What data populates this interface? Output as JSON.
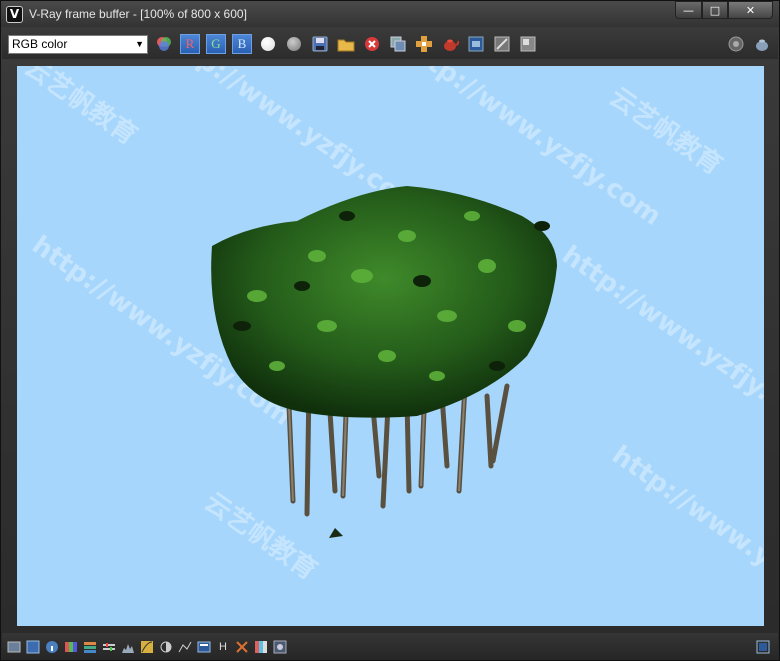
{
  "window": {
    "title": "V-Ray frame buffer - [100% of 800 x 600]",
    "icon": "vray-icon",
    "controls": [
      "minimize-icon",
      "maximize-icon",
      "close-icon"
    ]
  },
  "toolbar": {
    "channel_select": {
      "value": "RGB color"
    },
    "channel_buttons": [
      {
        "label": "R",
        "color": "#ff6060"
      },
      {
        "label": "G",
        "color": "#8fe28f"
      },
      {
        "label": "B",
        "color": "#d8e8ff"
      }
    ],
    "icons": [
      "color-wheel-icon",
      "white-circle-icon",
      "gray-circle-icon",
      "save-icon",
      "open-folder-icon",
      "clear-icon",
      "duplicate-icon",
      "track-mouse-icon",
      "render-teapot-icon",
      "film-strip-icon",
      "region-render-icon",
      "history-icon",
      "lens-effects-icon",
      "vfb-settings-icon"
    ]
  },
  "viewport": {
    "background": "#a6d6fc",
    "watermarks": [
      "云艺帆教育",
      "http://www.yzfjy.com"
    ]
  },
  "statusbar": {
    "icons": [
      "display-correction-icon",
      "panel-toggle-icon",
      "info-icon",
      "channels-icon",
      "color-bars-icon",
      "levels-icon",
      "histogram-icon",
      "curve-icon",
      "exposure-icon",
      "white-balance-icon",
      "lut-icon",
      "ocio-icon",
      "contrast-icon",
      "hue-icon",
      "hsl-icon",
      "sat-icon",
      "settings-icon",
      "expand-icon"
    ],
    "labels": {
      "h": "H"
    }
  }
}
